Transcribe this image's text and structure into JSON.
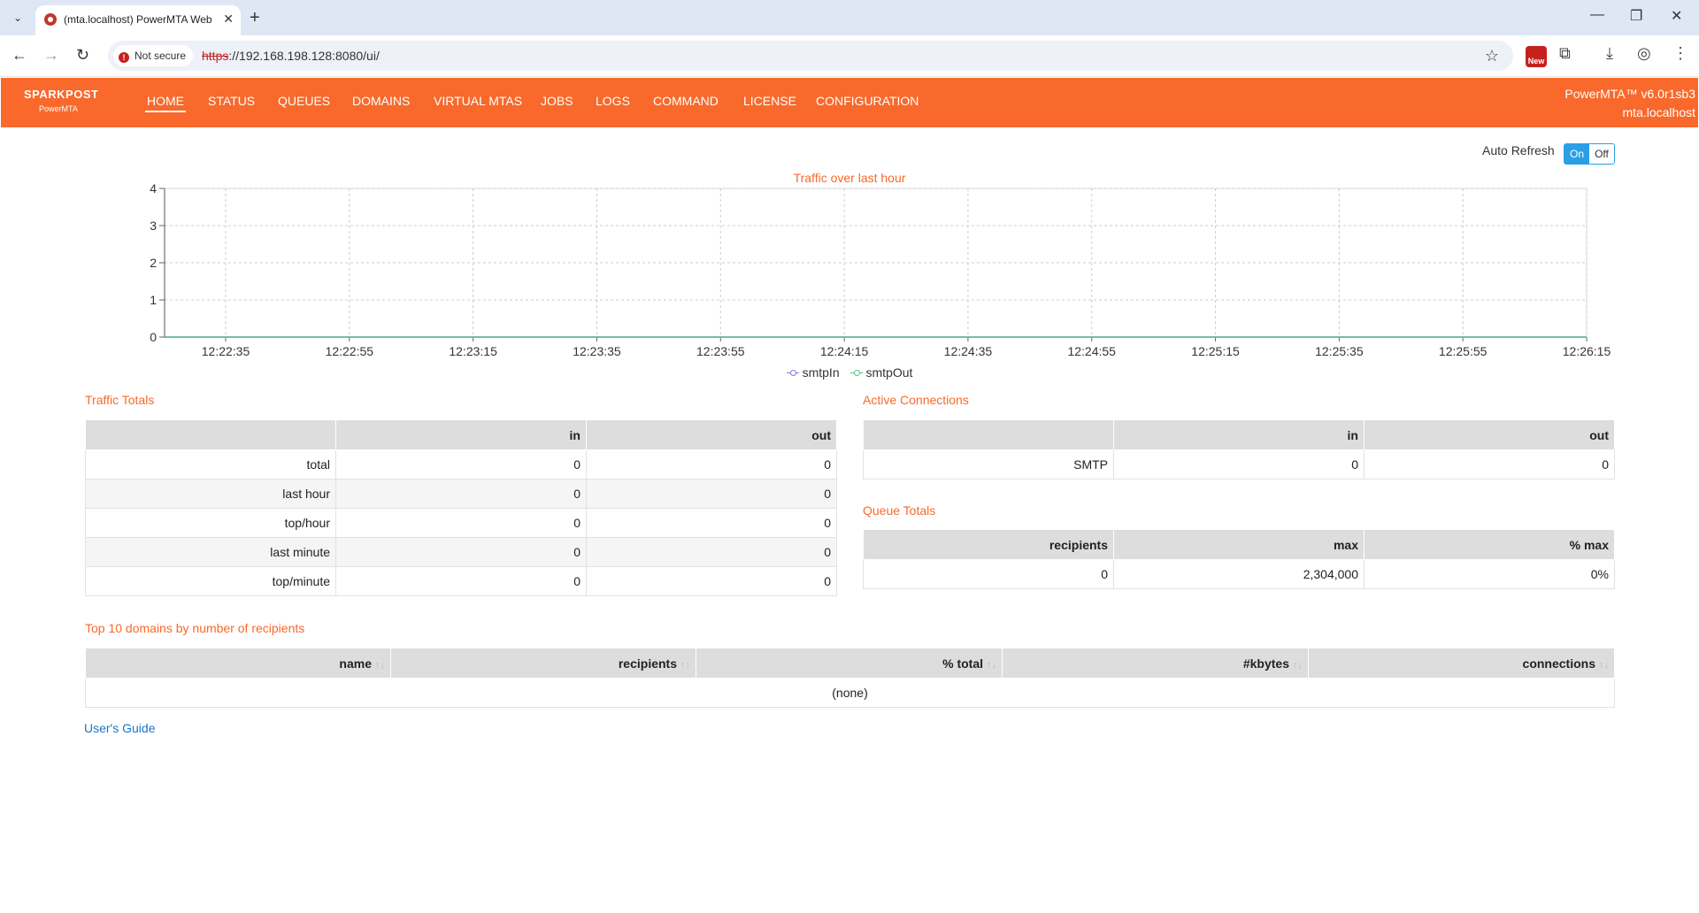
{
  "browser": {
    "tab_title": "(mta.localhost) PowerMTA Web",
    "security_label": "Not secure",
    "url_scheme": "https",
    "url_rest": "://192.168.198.128:8080/ui/",
    "new_badge": "New"
  },
  "app": {
    "logo_text": "SPARKPOST",
    "logo_sub": "PowerMTA",
    "nav": [
      "HOME",
      "STATUS",
      "QUEUES",
      "DOMAINS",
      "VIRTUAL MTAS",
      "JOBS",
      "LOGS",
      "COMMAND",
      "LICENSE",
      "CONFIGURATION"
    ],
    "active_nav": "HOME",
    "version": "PowerMTA™ v6.0r1sb3",
    "host": "mta.localhost",
    "accent_color": "#f8692b"
  },
  "auto_refresh": {
    "label": "Auto Refresh",
    "on": "On",
    "off": "Off",
    "state": "On"
  },
  "chart_data": {
    "type": "line",
    "title": "Traffic over last hour",
    "x": [
      "12:22:35",
      "12:22:55",
      "12:23:15",
      "12:23:35",
      "12:23:55",
      "12:24:15",
      "12:24:35",
      "12:24:55",
      "12:25:15",
      "12:25:35",
      "12:25:55",
      "12:26:15"
    ],
    "series": [
      {
        "name": "smtpIn",
        "color": "#7b7bd6",
        "values": [
          0,
          0,
          0,
          0,
          0,
          0,
          0,
          0,
          0,
          0,
          0,
          0
        ]
      },
      {
        "name": "smtpOut",
        "color": "#5cc08a",
        "values": [
          0,
          0,
          0,
          0,
          0,
          0,
          0,
          0,
          0,
          0,
          0,
          0
        ]
      }
    ],
    "yticks": [
      "0",
      "1",
      "2",
      "3",
      "4"
    ],
    "ylim": [
      0,
      4
    ],
    "grid": true,
    "legend": "bottom-center"
  },
  "traffic_totals": {
    "title": "Traffic Totals",
    "headers": [
      "",
      "in",
      "out"
    ],
    "rows": [
      [
        "total",
        "0",
        "0"
      ],
      [
        "last hour",
        "0",
        "0"
      ],
      [
        "top/hour",
        "0",
        "0"
      ],
      [
        "last minute",
        "0",
        "0"
      ],
      [
        "top/minute",
        "0",
        "0"
      ]
    ]
  },
  "active_connections": {
    "title": "Active Connections",
    "headers": [
      "",
      "in",
      "out"
    ],
    "rows": [
      [
        "SMTP",
        "0",
        "0"
      ]
    ]
  },
  "queue_totals": {
    "title": "Queue Totals",
    "headers": [
      "recipients",
      "max",
      "% max"
    ],
    "rows": [
      [
        "0",
        "2,304,000",
        "0%"
      ]
    ]
  },
  "top_domains": {
    "title": "Top 10 domains by number of recipients",
    "headers": [
      "name",
      "recipients",
      "% total",
      "#kbytes",
      "connections"
    ],
    "sort_glyph": "↑↓",
    "empty": "(none)"
  },
  "footer": {
    "users_guide": "User's Guide"
  }
}
